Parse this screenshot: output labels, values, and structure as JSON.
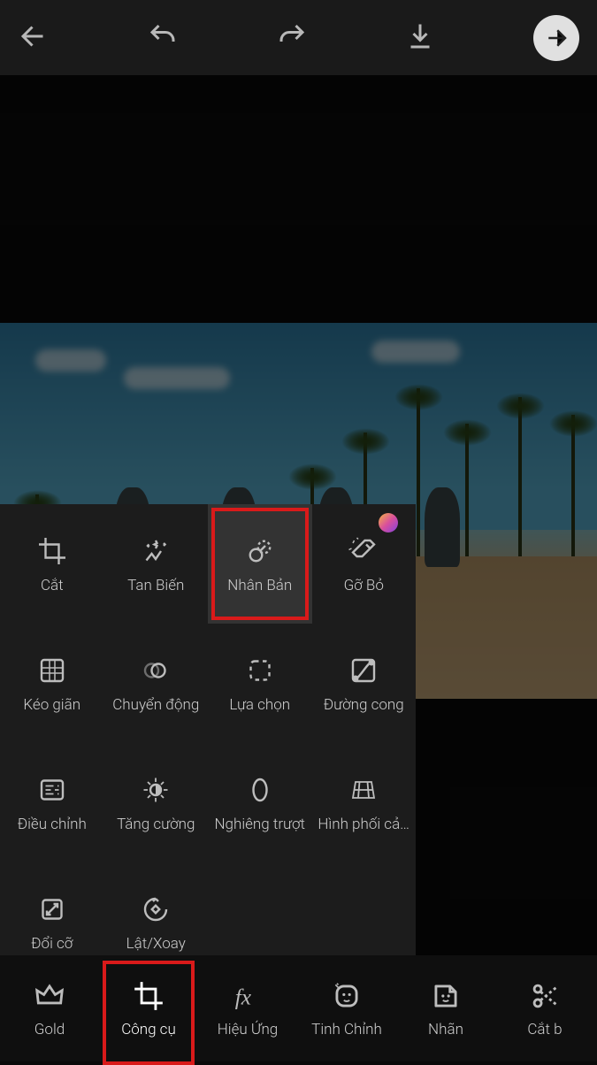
{
  "topbar": {
    "back": "back",
    "undo": "undo",
    "redo": "redo",
    "download": "download",
    "next": "next"
  },
  "tools": {
    "row1": [
      {
        "key": "crop",
        "label": "Cắt",
        "highlighted": false,
        "badge": false
      },
      {
        "key": "disperse",
        "label": "Tan Biến",
        "highlighted": false,
        "badge": false
      },
      {
        "key": "clone",
        "label": "Nhân Bản",
        "highlighted": true,
        "badge": false
      },
      {
        "key": "remove",
        "label": "Gỡ Bỏ",
        "highlighted": false,
        "badge": true
      }
    ],
    "row2": [
      {
        "key": "stretch",
        "label": "Kéo giãn",
        "highlighted": false,
        "badge": false
      },
      {
        "key": "motion",
        "label": "Chuyển động",
        "highlighted": false,
        "badge": false
      },
      {
        "key": "selection",
        "label": "Lựa chọn",
        "highlighted": false,
        "badge": false
      },
      {
        "key": "curves",
        "label": "Đường cong",
        "highlighted": false,
        "badge": false
      }
    ],
    "row3": [
      {
        "key": "adjust",
        "label": "Điều chỉnh",
        "highlighted": false,
        "badge": false
      },
      {
        "key": "enhance",
        "label": "Tăng cường",
        "highlighted": false,
        "badge": false
      },
      {
        "key": "tiltshift",
        "label": "Nghiêng trượt",
        "highlighted": false,
        "badge": false
      },
      {
        "key": "perspective",
        "label": "Hình phối cả…",
        "highlighted": false,
        "badge": false
      }
    ],
    "row4": [
      {
        "key": "resize",
        "label": "Đổi cỡ",
        "highlighted": false,
        "badge": false
      },
      {
        "key": "fliprotate",
        "label": "Lật/Xoay",
        "highlighted": false,
        "badge": false
      }
    ]
  },
  "bottombar": [
    {
      "key": "gold",
      "label": "Gold",
      "active": false
    },
    {
      "key": "tools",
      "label": "Công cụ",
      "active": true
    },
    {
      "key": "effects",
      "label": "Hiệu Ứng",
      "active": false
    },
    {
      "key": "retouch",
      "label": "Tinh Chỉnh",
      "active": false
    },
    {
      "key": "sticker",
      "label": "Nhãn",
      "active": false
    },
    {
      "key": "cutout",
      "label": "Cắt b",
      "active": false
    }
  ]
}
